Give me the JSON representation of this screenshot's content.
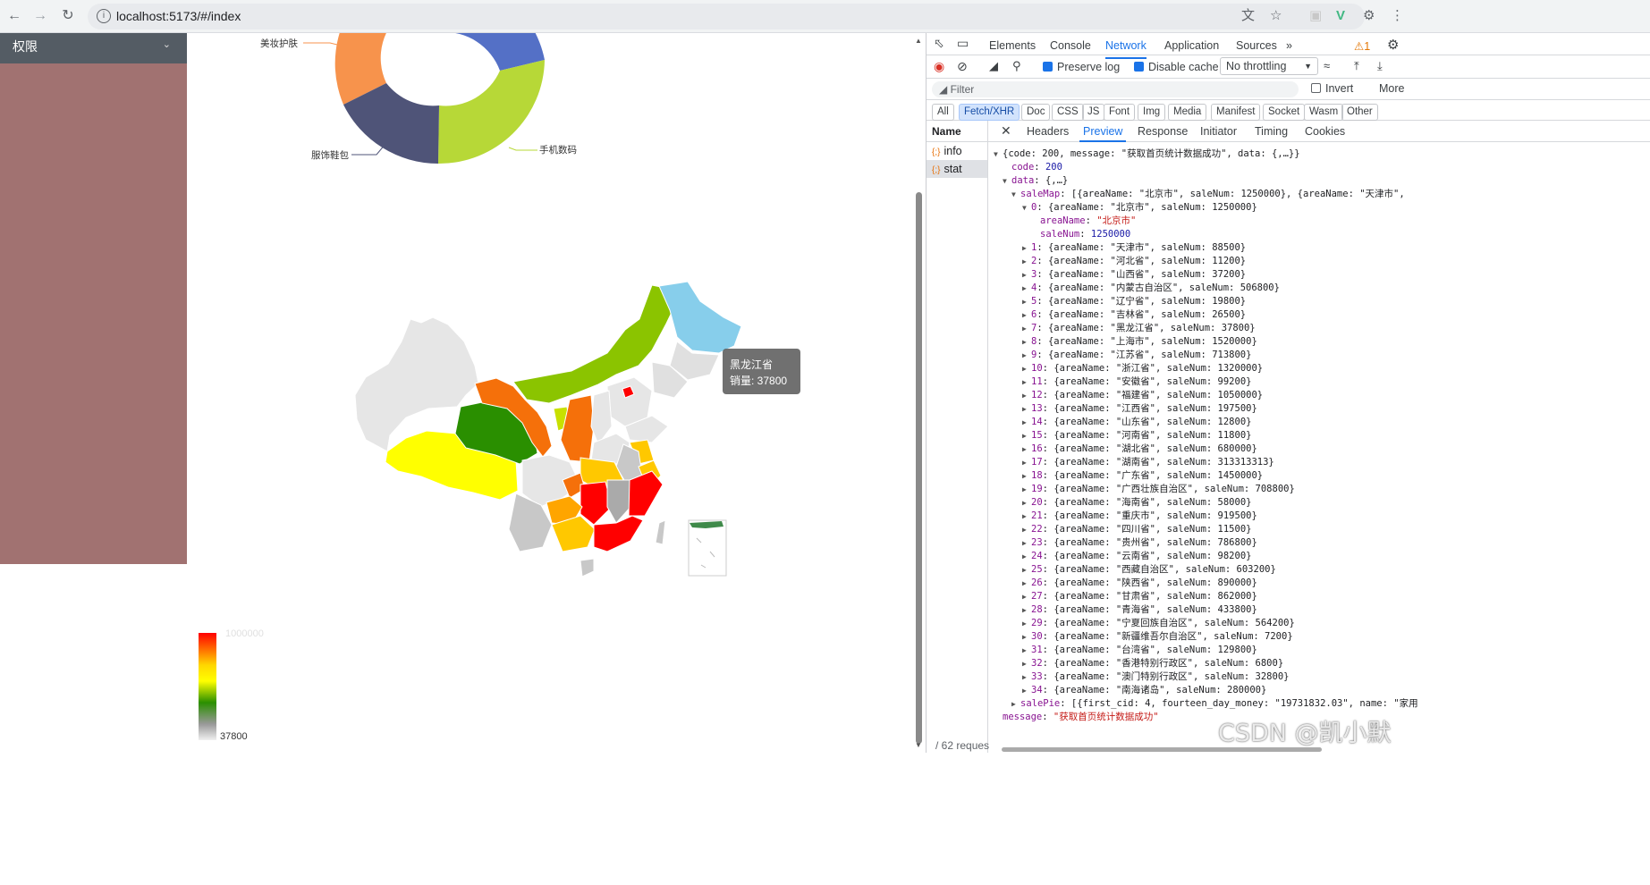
{
  "browser": {
    "url": "localhost:5173/#/index"
  },
  "sidebar": {
    "menu_title": "权限"
  },
  "pie": {
    "labels": [
      {
        "text": "美妆护肤"
      },
      {
        "text": "手机数码"
      },
      {
        "text": "服饰鞋包"
      }
    ],
    "colors": [
      "#f7934c",
      "#5470c6",
      "#b7d837",
      "#4f5478"
    ]
  },
  "map": {
    "tooltip": {
      "name": "黑龙江省",
      "value_label": "销量: 37800"
    },
    "visual_map": {
      "max_label": "1000000",
      "min_label": "37800"
    }
  },
  "devtools": {
    "tabs": [
      "Elements",
      "Console",
      "Network",
      "Application",
      "Sources"
    ],
    "active_tab": "Network",
    "warning_count": "1",
    "toolbar": {
      "preserve_log": "Preserve log",
      "disable_cache": "Disable cache",
      "throttling": "No throttling"
    },
    "filter": {
      "placeholder": "Filter",
      "invert": "Invert",
      "more": "More"
    },
    "type_filters": [
      "All",
      "Fetch/XHR",
      "Doc",
      "CSS",
      "JS",
      "Font",
      "Img",
      "Media",
      "Manifest",
      "Socket",
      "Wasm",
      "Other"
    ],
    "active_filter": "Fetch/XHR",
    "name_header": "Name",
    "requests": [
      "info",
      "stat"
    ],
    "selected_request": "stat",
    "footer": "/ 62 reques",
    "detail_tabs": [
      "Headers",
      "Preview",
      "Response",
      "Initiator",
      "Timing",
      "Cookies"
    ],
    "active_detail_tab": "Preview",
    "preview": {
      "root": "{code: 200, message: \"获取首页统计数据成功\", data: {,…}}",
      "code": "200",
      "data_summary": "{,…}",
      "saleMap_summary": "[{areaName: \"北京市\", saleNum: 1250000}, {areaName: \"天津市\",",
      "item0_summary": "{areaName: \"北京市\", saleNum: 1250000}",
      "item0_areaName": "\"北京市\"",
      "item0_saleNum": "1250000",
      "items": [
        {
          "i": "1",
          "text": "{areaName: \"天津市\", saleNum: 88500}"
        },
        {
          "i": "2",
          "text": "{areaName: \"河北省\", saleNum: 11200}"
        },
        {
          "i": "3",
          "text": "{areaName: \"山西省\", saleNum: 37200}"
        },
        {
          "i": "4",
          "text": "{areaName: \"内蒙古自治区\", saleNum: 506800}"
        },
        {
          "i": "5",
          "text": "{areaName: \"辽宁省\", saleNum: 19800}"
        },
        {
          "i": "6",
          "text": "{areaName: \"吉林省\", saleNum: 26500}"
        },
        {
          "i": "7",
          "text": "{areaName: \"黑龙江省\", saleNum: 37800}"
        },
        {
          "i": "8",
          "text": "{areaName: \"上海市\", saleNum: 1520000}"
        },
        {
          "i": "9",
          "text": "{areaName: \"江苏省\", saleNum: 713800}"
        },
        {
          "i": "10",
          "text": "{areaName: \"浙江省\", saleNum: 1320000}"
        },
        {
          "i": "11",
          "text": "{areaName: \"安徽省\", saleNum: 99200}"
        },
        {
          "i": "12",
          "text": "{areaName: \"福建省\", saleNum: 1050000}"
        },
        {
          "i": "13",
          "text": "{areaName: \"江西省\", saleNum: 197500}"
        },
        {
          "i": "14",
          "text": "{areaName: \"山东省\", saleNum: 12800}"
        },
        {
          "i": "15",
          "text": "{areaName: \"河南省\", saleNum: 11800}"
        },
        {
          "i": "16",
          "text": "{areaName: \"湖北省\", saleNum: 680000}"
        },
        {
          "i": "17",
          "text": "{areaName: \"湖南省\", saleNum: 313313313}"
        },
        {
          "i": "18",
          "text": "{areaName: \"广东省\", saleNum: 1450000}"
        },
        {
          "i": "19",
          "text": "{areaName: \"广西壮族自治区\", saleNum: 708800}"
        },
        {
          "i": "20",
          "text": "{areaName: \"海南省\", saleNum: 58000}"
        },
        {
          "i": "21",
          "text": "{areaName: \"重庆市\", saleNum: 919500}"
        },
        {
          "i": "22",
          "text": "{areaName: \"四川省\", saleNum: 11500}"
        },
        {
          "i": "23",
          "text": "{areaName: \"贵州省\", saleNum: 786800}"
        },
        {
          "i": "24",
          "text": "{areaName: \"云南省\", saleNum: 98200}"
        },
        {
          "i": "25",
          "text": "{areaName: \"西藏自治区\", saleNum: 603200}"
        },
        {
          "i": "26",
          "text": "{areaName: \"陕西省\", saleNum: 890000}"
        },
        {
          "i": "27",
          "text": "{areaName: \"甘肃省\", saleNum: 862000}"
        },
        {
          "i": "28",
          "text": "{areaName: \"青海省\", saleNum: 433800}"
        },
        {
          "i": "29",
          "text": "{areaName: \"宁夏回族自治区\", saleNum: 564200}"
        },
        {
          "i": "30",
          "text": "{areaName: \"新疆维吾尔自治区\", saleNum: 7200}"
        },
        {
          "i": "31",
          "text": "{areaName: \"台湾省\", saleNum: 129800}"
        },
        {
          "i": "32",
          "text": "{areaName: \"香港特别行政区\", saleNum: 6800}"
        },
        {
          "i": "33",
          "text": "{areaName: \"澳门特别行政区\", saleNum: 32800}"
        },
        {
          "i": "34",
          "text": "{areaName: \"南海诸岛\", saleNum: 280000}"
        }
      ],
      "salePie_summary": "[{first_cid: 4, fourteen_day_money: \"19731832.03\", name: \"家用",
      "message": "\"获取首页统计数据成功\""
    }
  },
  "watermark": "CSDN @凯小默"
}
